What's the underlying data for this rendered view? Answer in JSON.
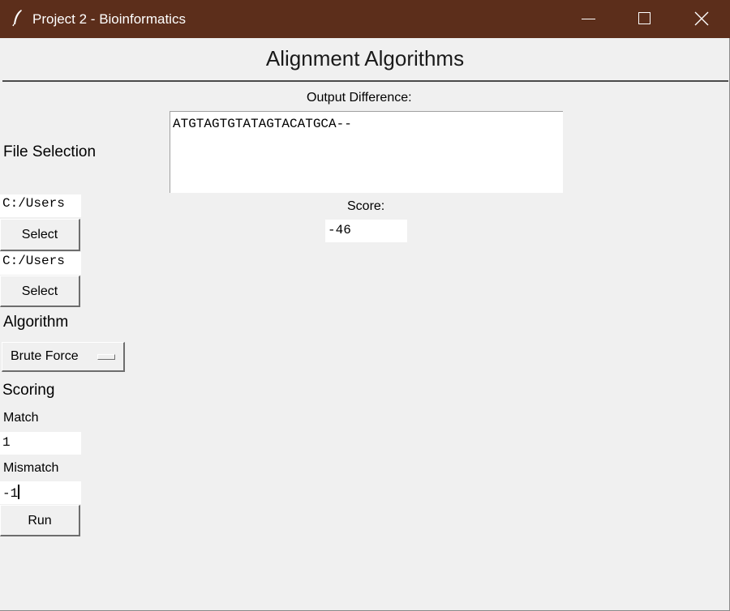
{
  "window": {
    "title": "Project 2 - Bioinformatics",
    "titlebar_color": "#5c2e1b"
  },
  "app": {
    "heading": "Alignment Algorithms",
    "file_selection_label": "File Selection",
    "file1": {
      "path": "C:/Users",
      "button": "Select"
    },
    "file2": {
      "path": "C:/Users",
      "button": "Select"
    },
    "algorithm_label": "Algorithm",
    "algorithm_selected": "Brute Force",
    "scoring_label": "Scoring",
    "match_label": "Match",
    "match_value": "1",
    "mismatch_label": "Mismatch",
    "mismatch_value": "-1",
    "run_button": "Run"
  },
  "output": {
    "difference_label": "Output Difference:",
    "difference_text": "ATGTAGTGTATAGTACATGCA--",
    "score_label": "Score:",
    "score_value": "-46"
  },
  "icons": {
    "app_icon": "feather-icon",
    "minimize": "minimize-icon",
    "maximize": "maximize-icon",
    "close": "close-icon"
  }
}
